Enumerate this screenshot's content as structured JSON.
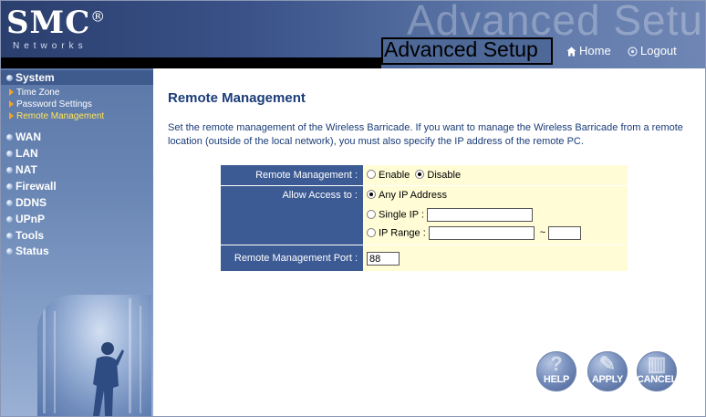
{
  "header": {
    "logo": "SMC",
    "logo_mark": "®",
    "logo_sub": "Networks",
    "ghost_title": "Advanced Setup",
    "page_heading": "Advanced Setup",
    "home_label": "Home",
    "logout_label": "Logout"
  },
  "sidebar": {
    "items": [
      {
        "label": "System",
        "active": true,
        "sub": [
          {
            "label": "Time Zone",
            "current": false
          },
          {
            "label": "Password Settings",
            "current": false
          },
          {
            "label": "Remote Management",
            "current": true
          }
        ]
      },
      {
        "label": "WAN"
      },
      {
        "label": "LAN"
      },
      {
        "label": "NAT"
      },
      {
        "label": "Firewall"
      },
      {
        "label": "DDNS"
      },
      {
        "label": "UPnP"
      },
      {
        "label": "Tools"
      },
      {
        "label": "Status"
      }
    ]
  },
  "main": {
    "title": "Remote Management",
    "description": "Set the remote management of the Wireless Barricade. If you want to manage the Wireless Barricade from a remote location (outside of the local network), you must also specify the IP address of the remote PC.",
    "form": {
      "remote_mgmt_label": "Remote Management :",
      "enable_label": "Enable",
      "disable_label": "Disable",
      "remote_mgmt_value": "Disable",
      "allow_access_label": "Allow Access to :",
      "any_ip_label": "Any IP Address",
      "single_ip_label": "Single IP :",
      "single_ip_value": "",
      "ip_range_label": "IP Range :",
      "ip_range_start": "",
      "ip_range_sep": "~",
      "ip_range_end": "",
      "allow_access_value": "Any IP Address",
      "port_label": "Remote Management Port :",
      "port_value": "88"
    },
    "buttons": {
      "help": "HELP",
      "apply": "APPLY",
      "cancel": "CANCEL"
    }
  },
  "colors": {
    "header_bg": "#3e5a8e",
    "label_bg": "#3c5a94",
    "value_bg": "#fffcd6",
    "title_text": "#1a3c78",
    "current_nav": "#ffe55a",
    "nav_arrow": "#f3a322"
  }
}
